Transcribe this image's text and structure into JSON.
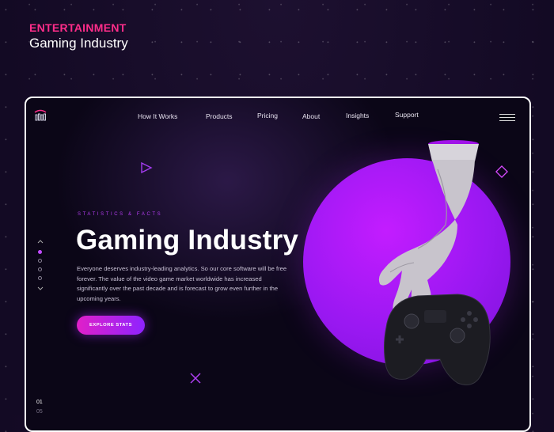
{
  "header": {
    "category": "ENTERTAINMENT",
    "title": "Gaming Industry"
  },
  "nav": {
    "items": [
      "How It Works",
      "Products",
      "Pricing",
      "About",
      "Insights",
      "Support"
    ]
  },
  "hero": {
    "eyebrow": "STATISTICS & FACTS",
    "title": "Gaming Industry",
    "description": "Everyone deserves industry-leading analytics. So our core software will be free forever. The value of the video game market worldwide has increased significantly over the past decade  and is forecast to grow even further in the upcoming years.",
    "cta_label": "EXPLORE STATS"
  },
  "pagination": {
    "current": "01",
    "total": "05"
  },
  "colors": {
    "accent_pink": "#ff2d8a",
    "accent_purple": "#a81cff",
    "background": "#0b0617"
  }
}
